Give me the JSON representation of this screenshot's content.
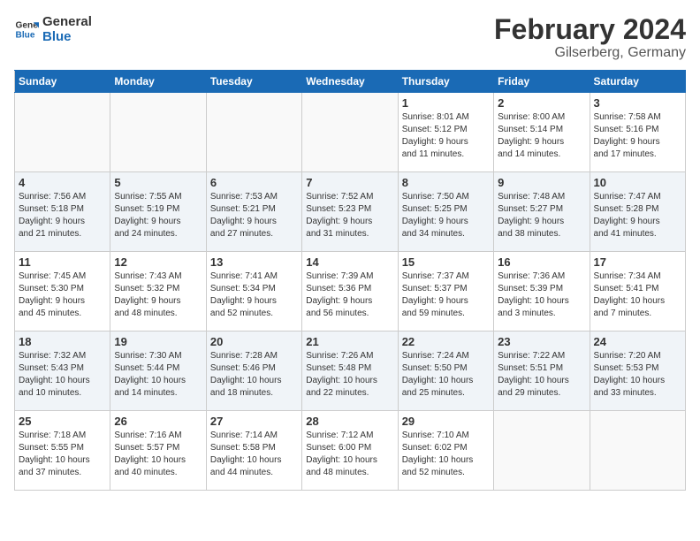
{
  "header": {
    "logo_line1": "General",
    "logo_line2": "Blue",
    "title": "February 2024",
    "subtitle": "Gilserberg, Germany"
  },
  "days_of_week": [
    "Sunday",
    "Monday",
    "Tuesday",
    "Wednesday",
    "Thursday",
    "Friday",
    "Saturday"
  ],
  "weeks": [
    [
      {
        "day": "",
        "info": ""
      },
      {
        "day": "",
        "info": ""
      },
      {
        "day": "",
        "info": ""
      },
      {
        "day": "",
        "info": ""
      },
      {
        "day": "1",
        "info": "Sunrise: 8:01 AM\nSunset: 5:12 PM\nDaylight: 9 hours\nand 11 minutes."
      },
      {
        "day": "2",
        "info": "Sunrise: 8:00 AM\nSunset: 5:14 PM\nDaylight: 9 hours\nand 14 minutes."
      },
      {
        "day": "3",
        "info": "Sunrise: 7:58 AM\nSunset: 5:16 PM\nDaylight: 9 hours\nand 17 minutes."
      }
    ],
    [
      {
        "day": "4",
        "info": "Sunrise: 7:56 AM\nSunset: 5:18 PM\nDaylight: 9 hours\nand 21 minutes."
      },
      {
        "day": "5",
        "info": "Sunrise: 7:55 AM\nSunset: 5:19 PM\nDaylight: 9 hours\nand 24 minutes."
      },
      {
        "day": "6",
        "info": "Sunrise: 7:53 AM\nSunset: 5:21 PM\nDaylight: 9 hours\nand 27 minutes."
      },
      {
        "day": "7",
        "info": "Sunrise: 7:52 AM\nSunset: 5:23 PM\nDaylight: 9 hours\nand 31 minutes."
      },
      {
        "day": "8",
        "info": "Sunrise: 7:50 AM\nSunset: 5:25 PM\nDaylight: 9 hours\nand 34 minutes."
      },
      {
        "day": "9",
        "info": "Sunrise: 7:48 AM\nSunset: 5:27 PM\nDaylight: 9 hours\nand 38 minutes."
      },
      {
        "day": "10",
        "info": "Sunrise: 7:47 AM\nSunset: 5:28 PM\nDaylight: 9 hours\nand 41 minutes."
      }
    ],
    [
      {
        "day": "11",
        "info": "Sunrise: 7:45 AM\nSunset: 5:30 PM\nDaylight: 9 hours\nand 45 minutes."
      },
      {
        "day": "12",
        "info": "Sunrise: 7:43 AM\nSunset: 5:32 PM\nDaylight: 9 hours\nand 48 minutes."
      },
      {
        "day": "13",
        "info": "Sunrise: 7:41 AM\nSunset: 5:34 PM\nDaylight: 9 hours\nand 52 minutes."
      },
      {
        "day": "14",
        "info": "Sunrise: 7:39 AM\nSunset: 5:36 PM\nDaylight: 9 hours\nand 56 minutes."
      },
      {
        "day": "15",
        "info": "Sunrise: 7:37 AM\nSunset: 5:37 PM\nDaylight: 9 hours\nand 59 minutes."
      },
      {
        "day": "16",
        "info": "Sunrise: 7:36 AM\nSunset: 5:39 PM\nDaylight: 10 hours\nand 3 minutes."
      },
      {
        "day": "17",
        "info": "Sunrise: 7:34 AM\nSunset: 5:41 PM\nDaylight: 10 hours\nand 7 minutes."
      }
    ],
    [
      {
        "day": "18",
        "info": "Sunrise: 7:32 AM\nSunset: 5:43 PM\nDaylight: 10 hours\nand 10 minutes."
      },
      {
        "day": "19",
        "info": "Sunrise: 7:30 AM\nSunset: 5:44 PM\nDaylight: 10 hours\nand 14 minutes."
      },
      {
        "day": "20",
        "info": "Sunrise: 7:28 AM\nSunset: 5:46 PM\nDaylight: 10 hours\nand 18 minutes."
      },
      {
        "day": "21",
        "info": "Sunrise: 7:26 AM\nSunset: 5:48 PM\nDaylight: 10 hours\nand 22 minutes."
      },
      {
        "day": "22",
        "info": "Sunrise: 7:24 AM\nSunset: 5:50 PM\nDaylight: 10 hours\nand 25 minutes."
      },
      {
        "day": "23",
        "info": "Sunrise: 7:22 AM\nSunset: 5:51 PM\nDaylight: 10 hours\nand 29 minutes."
      },
      {
        "day": "24",
        "info": "Sunrise: 7:20 AM\nSunset: 5:53 PM\nDaylight: 10 hours\nand 33 minutes."
      }
    ],
    [
      {
        "day": "25",
        "info": "Sunrise: 7:18 AM\nSunset: 5:55 PM\nDaylight: 10 hours\nand 37 minutes."
      },
      {
        "day": "26",
        "info": "Sunrise: 7:16 AM\nSunset: 5:57 PM\nDaylight: 10 hours\nand 40 minutes."
      },
      {
        "day": "27",
        "info": "Sunrise: 7:14 AM\nSunset: 5:58 PM\nDaylight: 10 hours\nand 44 minutes."
      },
      {
        "day": "28",
        "info": "Sunrise: 7:12 AM\nSunset: 6:00 PM\nDaylight: 10 hours\nand 48 minutes."
      },
      {
        "day": "29",
        "info": "Sunrise: 7:10 AM\nSunset: 6:02 PM\nDaylight: 10 hours\nand 52 minutes."
      },
      {
        "day": "",
        "info": ""
      },
      {
        "day": "",
        "info": ""
      }
    ]
  ]
}
